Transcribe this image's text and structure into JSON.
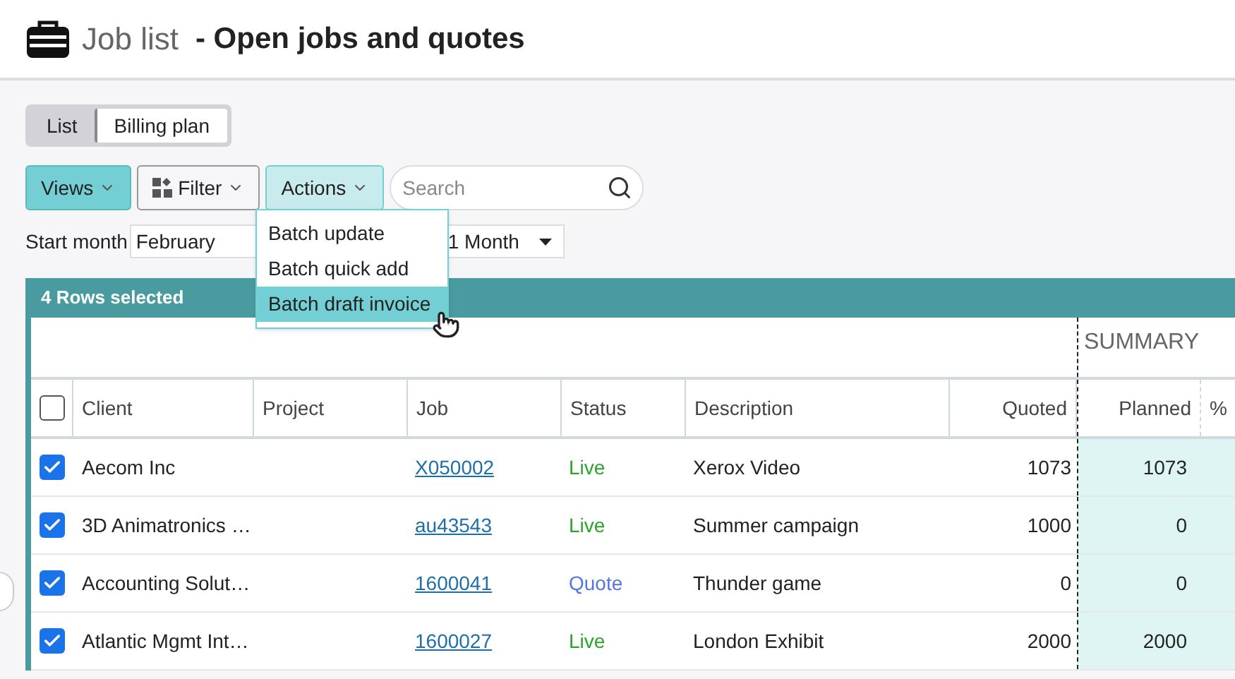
{
  "header": {
    "title": "Job list",
    "subtitle": "- Open jobs and quotes"
  },
  "view_tabs": [
    {
      "label": "List",
      "selected": false
    },
    {
      "label": "Billing plan",
      "selected": true
    }
  ],
  "toolbar": {
    "buttons": [
      {
        "label": "Views",
        "kind": "primary"
      },
      {
        "label": "Filter",
        "kind": "filter"
      },
      {
        "label": "Actions",
        "kind": "open"
      }
    ],
    "search": {
      "placeholder": "Search"
    }
  },
  "start_month": {
    "label": "Start month",
    "value": "February"
  },
  "period": {
    "value": "1 Month"
  },
  "actions_menu": [
    {
      "label": "Batch update",
      "selected": false
    },
    {
      "label": "Batch quick add",
      "selected": false
    },
    {
      "label": "Batch draft invoice",
      "selected": true
    }
  ],
  "table": {
    "selection_banner": "4 Rows selected",
    "group_heading": "SUMMARY",
    "select_all_checked": false,
    "columns": [
      {
        "label": "Client",
        "numeric": false
      },
      {
        "label": "Project",
        "numeric": false
      },
      {
        "label": "Job",
        "numeric": false
      },
      {
        "label": "Status",
        "numeric": false
      },
      {
        "label": "Description",
        "numeric": false
      },
      {
        "label": "Quoted",
        "numeric": true
      },
      {
        "label": "Planned",
        "numeric": true
      },
      {
        "label": "%",
        "numeric": false
      }
    ],
    "rows": [
      {
        "checked": true,
        "client": "Aecom Inc",
        "job": "X050002",
        "status": "Live",
        "color": "#2aa52a",
        "description": "Xerox Video",
        "quoted": "1073",
        "planned": "1073"
      },
      {
        "checked": true,
        "client": "3D Animatronics …",
        "job": "au43543",
        "status": "Live",
        "color": "#2aa52a",
        "description": "Summer campaign",
        "quoted": "1000",
        "planned": "0"
      },
      {
        "checked": true,
        "client": "Accounting Solut…",
        "job": "1600041",
        "status": "Quote",
        "color": "#5577dd",
        "description": "Thunder game",
        "quoted": "0",
        "planned": "0"
      },
      {
        "checked": true,
        "client": "Atlantic Mgmt Int…",
        "job": "1600027",
        "status": "Live",
        "color": "#2aa52a",
        "description": "London Exhibit",
        "quoted": "2000",
        "planned": "2000"
      }
    ]
  }
}
